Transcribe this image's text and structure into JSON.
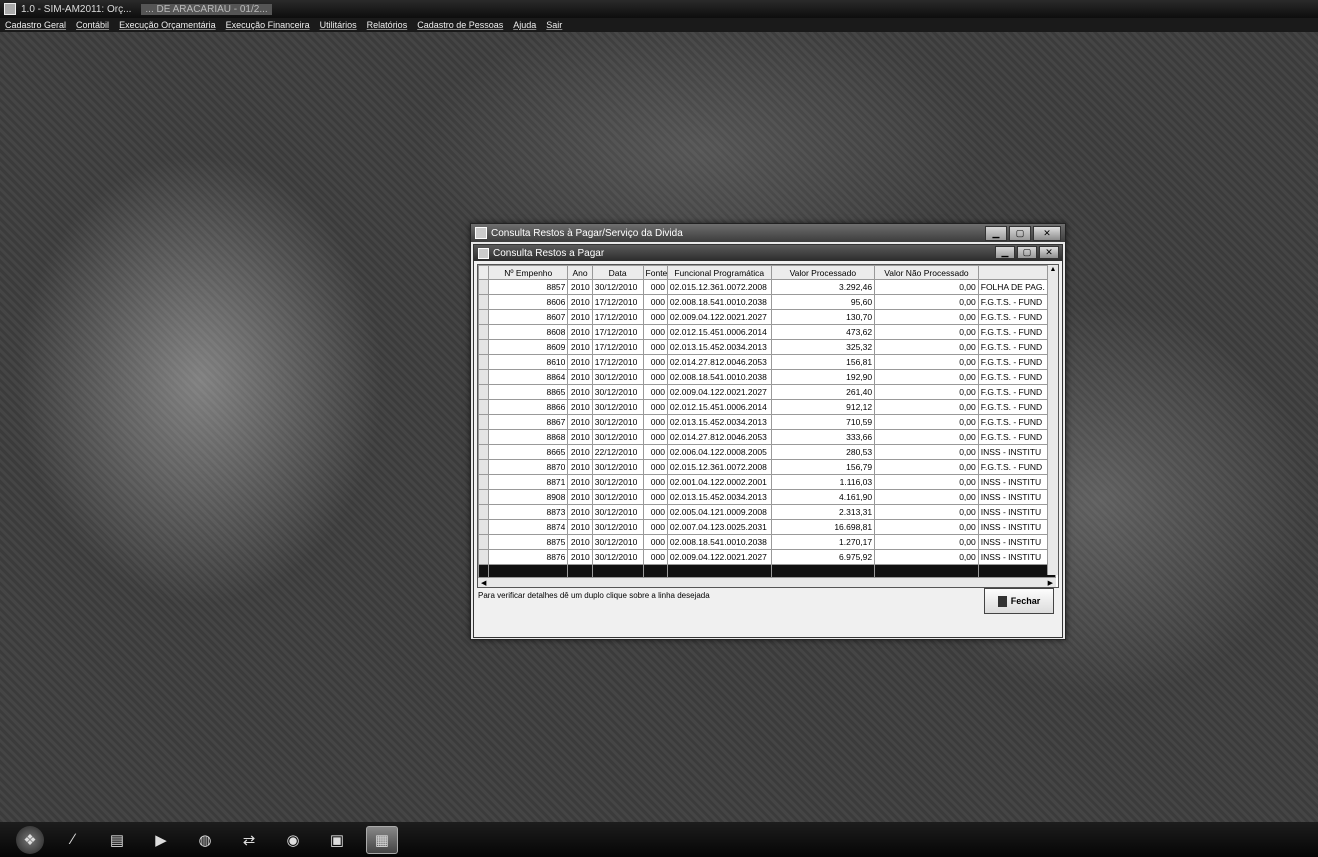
{
  "app": {
    "title": "1.0 - SIM-AM2011: Orç...",
    "subtitle": "... DE ARACARIAU - 01/2..."
  },
  "menu": [
    "Cadastro Geral",
    "Contábil",
    "Execução Orçamentária",
    "Execução Financeira",
    "Utilitários",
    "Relatórios",
    "Cadastro de Pessoas",
    "Ajuda",
    "Sair"
  ],
  "outer_window": {
    "title": "Consulta Restos à Pagar/Serviço da Divida"
  },
  "inner_window": {
    "title": "Consulta Restos a Pagar"
  },
  "grid": {
    "columns": [
      "Nº Empenho",
      "Ano",
      "Data",
      "Fonte",
      "Funcional Programática",
      "Valor Processado",
      "Valor Não Processado",
      ""
    ],
    "rows": [
      [
        "8857",
        "2010",
        "30/12/2010",
        "000",
        "02.015.12.361.0072.2008",
        "3.292,46",
        "0,00",
        "FOLHA DE PAG."
      ],
      [
        "8606",
        "2010",
        "17/12/2010",
        "000",
        "02.008.18.541.0010.2038",
        "95,60",
        "0,00",
        "F.G.T.S. - FUND"
      ],
      [
        "8607",
        "2010",
        "17/12/2010",
        "000",
        "02.009.04.122.0021.2027",
        "130,70",
        "0,00",
        "F.G.T.S. - FUND"
      ],
      [
        "8608",
        "2010",
        "17/12/2010",
        "000",
        "02.012.15.451.0006.2014",
        "473,62",
        "0,00",
        "F.G.T.S. - FUND"
      ],
      [
        "8609",
        "2010",
        "17/12/2010",
        "000",
        "02.013.15.452.0034.2013",
        "325,32",
        "0,00",
        "F.G.T.S. - FUND"
      ],
      [
        "8610",
        "2010",
        "17/12/2010",
        "000",
        "02.014.27.812.0046.2053",
        "156,81",
        "0,00",
        "F.G.T.S. - FUND"
      ],
      [
        "8864",
        "2010",
        "30/12/2010",
        "000",
        "02.008.18.541.0010.2038",
        "192,90",
        "0,00",
        "F.G.T.S. - FUND"
      ],
      [
        "8865",
        "2010",
        "30/12/2010",
        "000",
        "02.009.04.122.0021.2027",
        "261,40",
        "0,00",
        "F.G.T.S. - FUND"
      ],
      [
        "8866",
        "2010",
        "30/12/2010",
        "000",
        "02.012.15.451.0006.2014",
        "912,12",
        "0,00",
        "F.G.T.S. - FUND"
      ],
      [
        "8867",
        "2010",
        "30/12/2010",
        "000",
        "02.013.15.452.0034.2013",
        "710,59",
        "0,00",
        "F.G.T.S. - FUND"
      ],
      [
        "8868",
        "2010",
        "30/12/2010",
        "000",
        "02.014.27.812.0046.2053",
        "333,66",
        "0,00",
        "F.G.T.S. - FUND"
      ],
      [
        "8665",
        "2010",
        "22/12/2010",
        "000",
        "02.006.04.122.0008.2005",
        "280,53",
        "0,00",
        "INSS - INSTITU"
      ],
      [
        "8870",
        "2010",
        "30/12/2010",
        "000",
        "02.015.12.361.0072.2008",
        "156,79",
        "0,00",
        "F.G.T.S. - FUND"
      ],
      [
        "8871",
        "2010",
        "30/12/2010",
        "000",
        "02.001.04.122.0002.2001",
        "1.116,03",
        "0,00",
        "INSS - INSTITU"
      ],
      [
        "8908",
        "2010",
        "30/12/2010",
        "000",
        "02.013.15.452.0034.2013",
        "4.161,90",
        "0,00",
        "INSS - INSTITU"
      ],
      [
        "8873",
        "2010",
        "30/12/2010",
        "000",
        "02.005.04.121.0009.2008",
        "2.313,31",
        "0,00",
        "INSS - INSTITU"
      ],
      [
        "8874",
        "2010",
        "30/12/2010",
        "000",
        "02.007.04.123.0025.2031",
        "16.698,81",
        "0,00",
        "INSS - INSTITU"
      ],
      [
        "8875",
        "2010",
        "30/12/2010",
        "000",
        "02.008.18.541.0010.2038",
        "1.270,17",
        "0,00",
        "INSS - INSTITU"
      ],
      [
        "8876",
        "2010",
        "30/12/2010",
        "000",
        "02.009.04.122.0021.2027",
        "6.975,92",
        "0,00",
        "INSS - INSTITU"
      ]
    ]
  },
  "hint": "Para verificar detalhes dê um duplo clique sobre a linha desejada",
  "close_button": "Fechar",
  "taskbar_icons": [
    "start-orb-icon",
    "pen-icon",
    "explorer-icon",
    "media-icon",
    "globe-icon",
    "network-icon",
    "display-icon",
    "window-icon",
    "notepad-icon"
  ]
}
